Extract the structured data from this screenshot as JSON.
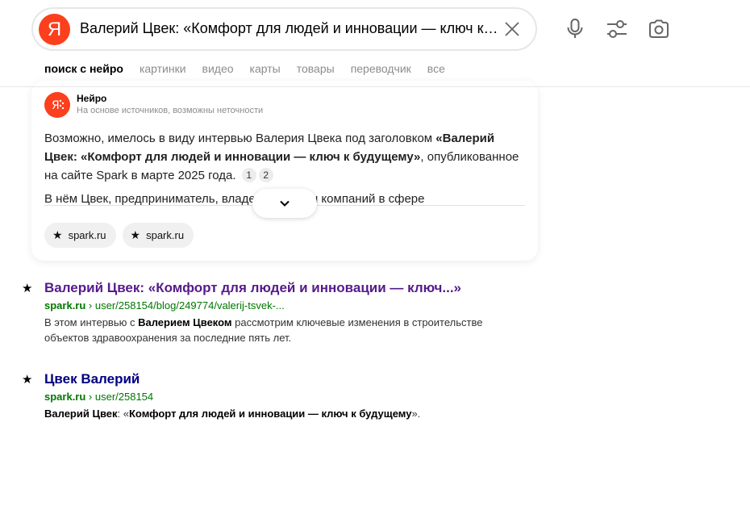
{
  "search": {
    "logo": "Я",
    "query": "Валерий Цвек: «Комфорт для людей и инновации — ключ к будущему»"
  },
  "icons": {
    "clear": "close-icon",
    "voice": "microphone-icon",
    "filters": "filter-sliders-icon",
    "image_search": "camera-icon"
  },
  "tabs": [
    {
      "label": "поиск с нейро",
      "active": true
    },
    {
      "label": "картинки"
    },
    {
      "label": "видео"
    },
    {
      "label": "карты"
    },
    {
      "label": "товары"
    },
    {
      "label": "переводчик"
    },
    {
      "label": "все"
    }
  ],
  "neuro": {
    "name": "Нейро",
    "subtitle": "На основе источников, возможны неточности",
    "p1_a": "Возможно, имелось в виду интервью Валерия Цвека под заголовком ",
    "p1_b": "«Валерий Цвек: «Комфорт для людей и инновации — ключ к будущему»",
    "p1_c": ", опубликованное на сайте Spark в марте 2025 года.",
    "ref1": "1",
    "ref2": "2",
    "p2": "В нём Цвек, предприниматель, владелец группы компаний в сфере",
    "chips": [
      {
        "label": "spark.ru"
      },
      {
        "label": "spark.ru"
      }
    ]
  },
  "results": [
    {
      "title": "Валерий Цвек: «Комфорт для людей и инновации — ключ...»",
      "title_color": "#551a8b",
      "domain": "spark.ru",
      "path": " › user/258154/blog/249774/valerij-tsvek-...",
      "snip_a": "В этом интервью с ",
      "snip_b": "Валерием Цвеком",
      "snip_c": " рассмотрим ключевые изменения в строительстве объектов здравоохранения за последние пять лет."
    },
    {
      "title": "Цвек Валерий",
      "title_color": "#000080",
      "domain": "spark.ru",
      "path": " › user/258154",
      "snip_a": "Валерий Цвек",
      "snip_b": ": «",
      "snip_c": "Комфорт для людей и инновации — ключ к будущему",
      "snip_d": "»."
    }
  ]
}
